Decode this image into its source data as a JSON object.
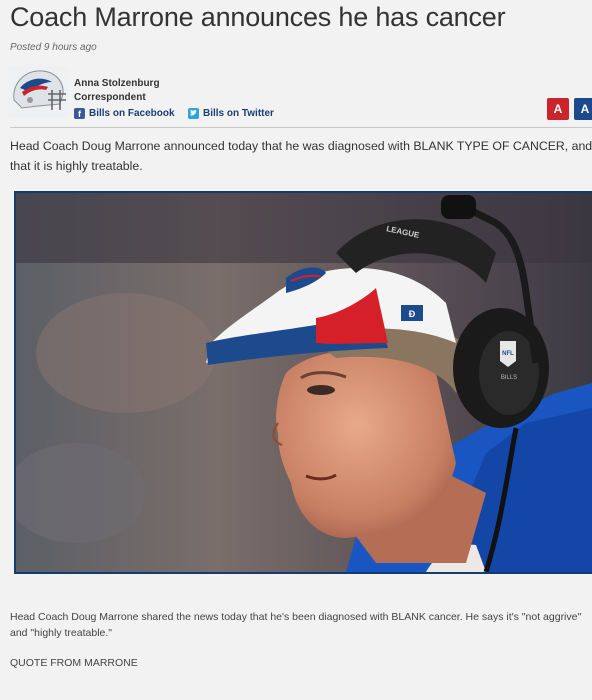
{
  "article": {
    "headline": "Coach Marrone announces he has cancer",
    "posted": "Posted 9 hours ago",
    "author": {
      "name": "Anna Stolzenburg",
      "role": "Correspondent"
    },
    "social": {
      "facebook_label": "Bills on Facebook",
      "twitter_label": "Bills on Twitter"
    },
    "font_controls": {
      "small_label": "A",
      "large_label": "A",
      "small_color": "#c9252b",
      "large_color": "#1c4a8c"
    },
    "lead": "Head Coach Doug Marrone announced today that he was diagnosed with BLANK TYPE OF CANCER, and that it is highly treatable.",
    "caption": "Head Coach Doug Marrone shared the news today that he's been diagnosed with BLANK cancer. He says it's \"not aggrive\" and \"highly treatable.\"",
    "quote": "QUOTE FROM MARRONE"
  },
  "colors": {
    "headset_badge": "NFL",
    "headset_label": "BILLS",
    "visor_text": "LEAGUE"
  },
  "icons": {
    "avatar": "bills-helmet-icon",
    "facebook": "facebook-icon",
    "twitter": "twitter-icon"
  }
}
